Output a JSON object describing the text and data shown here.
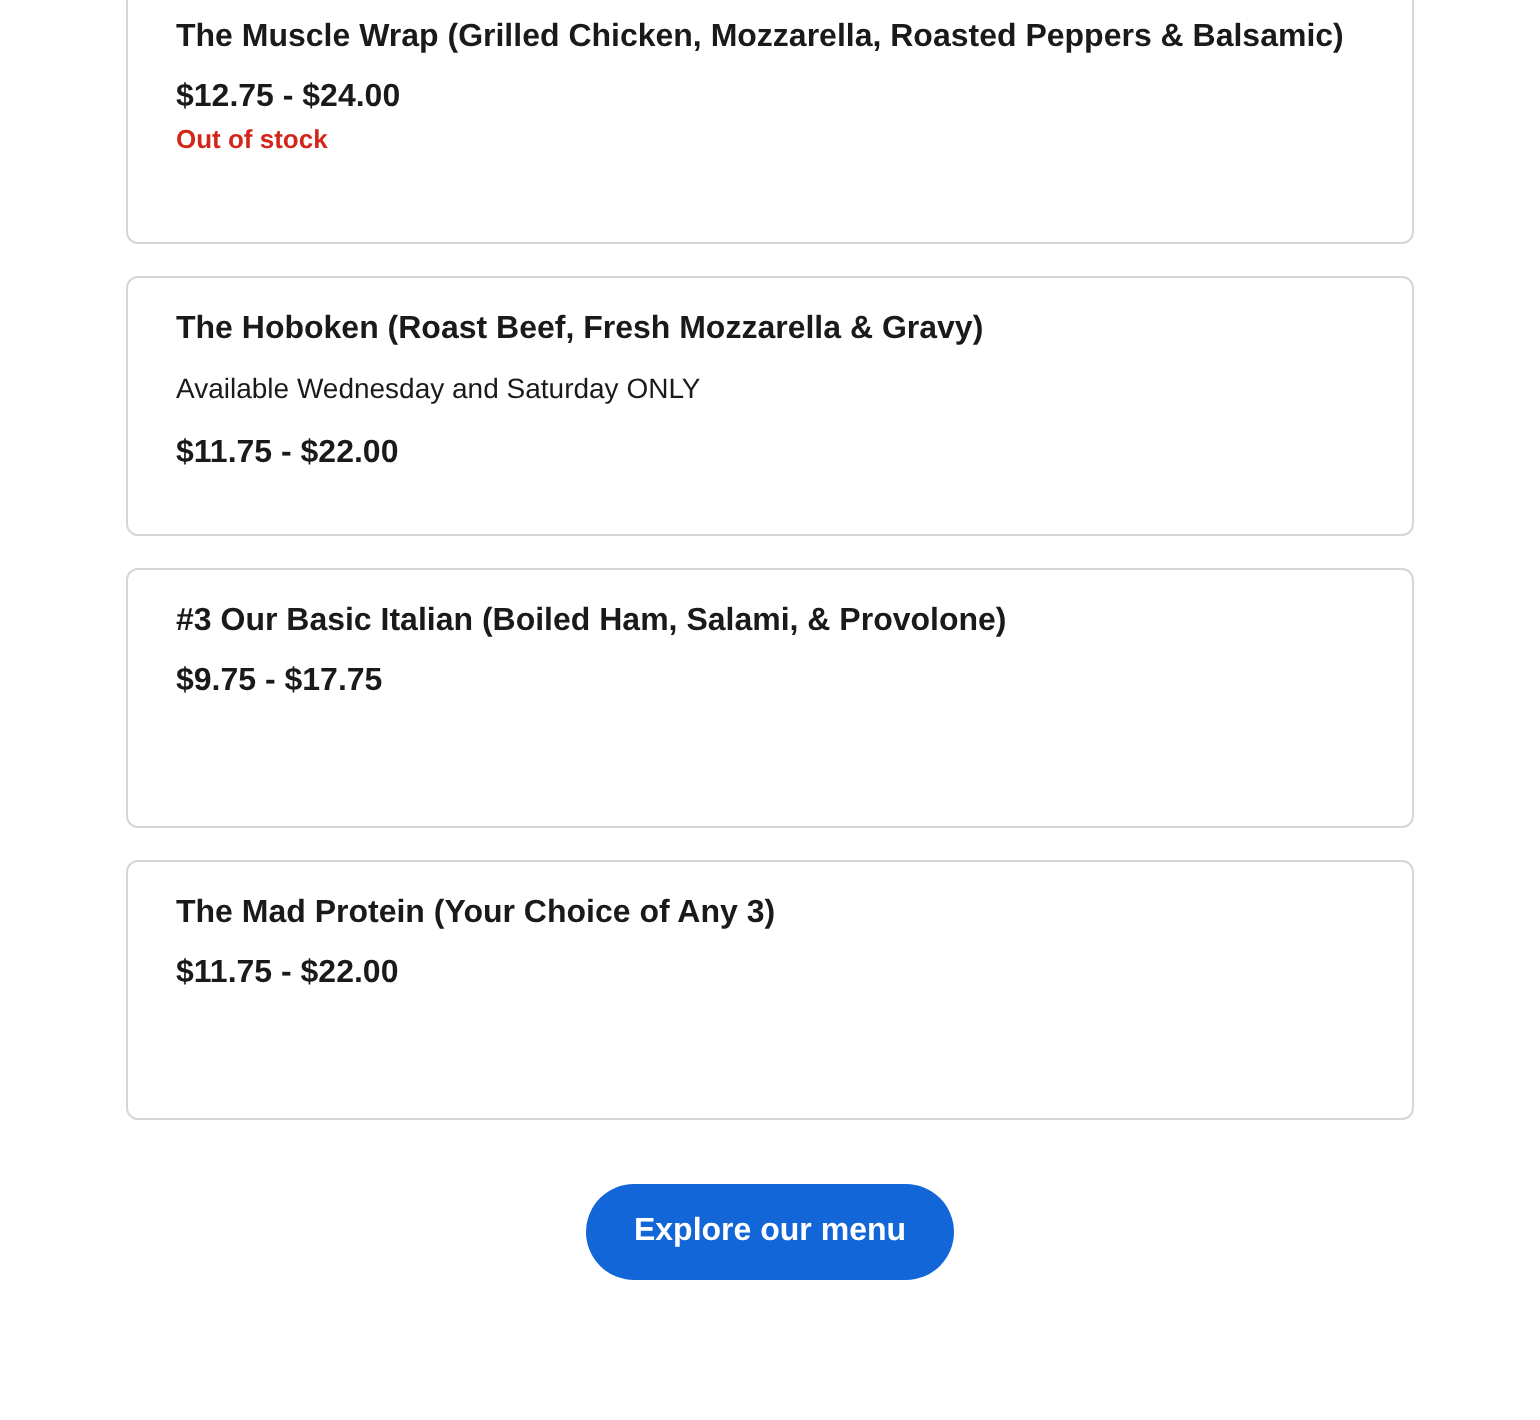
{
  "menu_items": [
    {
      "title": "The Muscle Wrap (Grilled Chicken, Mozzarella, Roasted Peppers & Balsamic)",
      "price": "$12.75 - $24.00",
      "stock_note": "Out of stock"
    },
    {
      "title": "The Hoboken (Roast Beef, Fresh Mozzarella & Gravy)",
      "description": "Available Wednesday and Saturday ONLY",
      "price": "$11.75 - $22.00"
    },
    {
      "title": "#3 Our Basic Italian (Boiled Ham, Salami, & Provolone)",
      "price": "$9.75 - $17.75"
    },
    {
      "title": "The Mad Protein (Your Choice of Any 3)",
      "price": "$11.75 - $22.00"
    }
  ],
  "explore_button": "Explore our menu"
}
